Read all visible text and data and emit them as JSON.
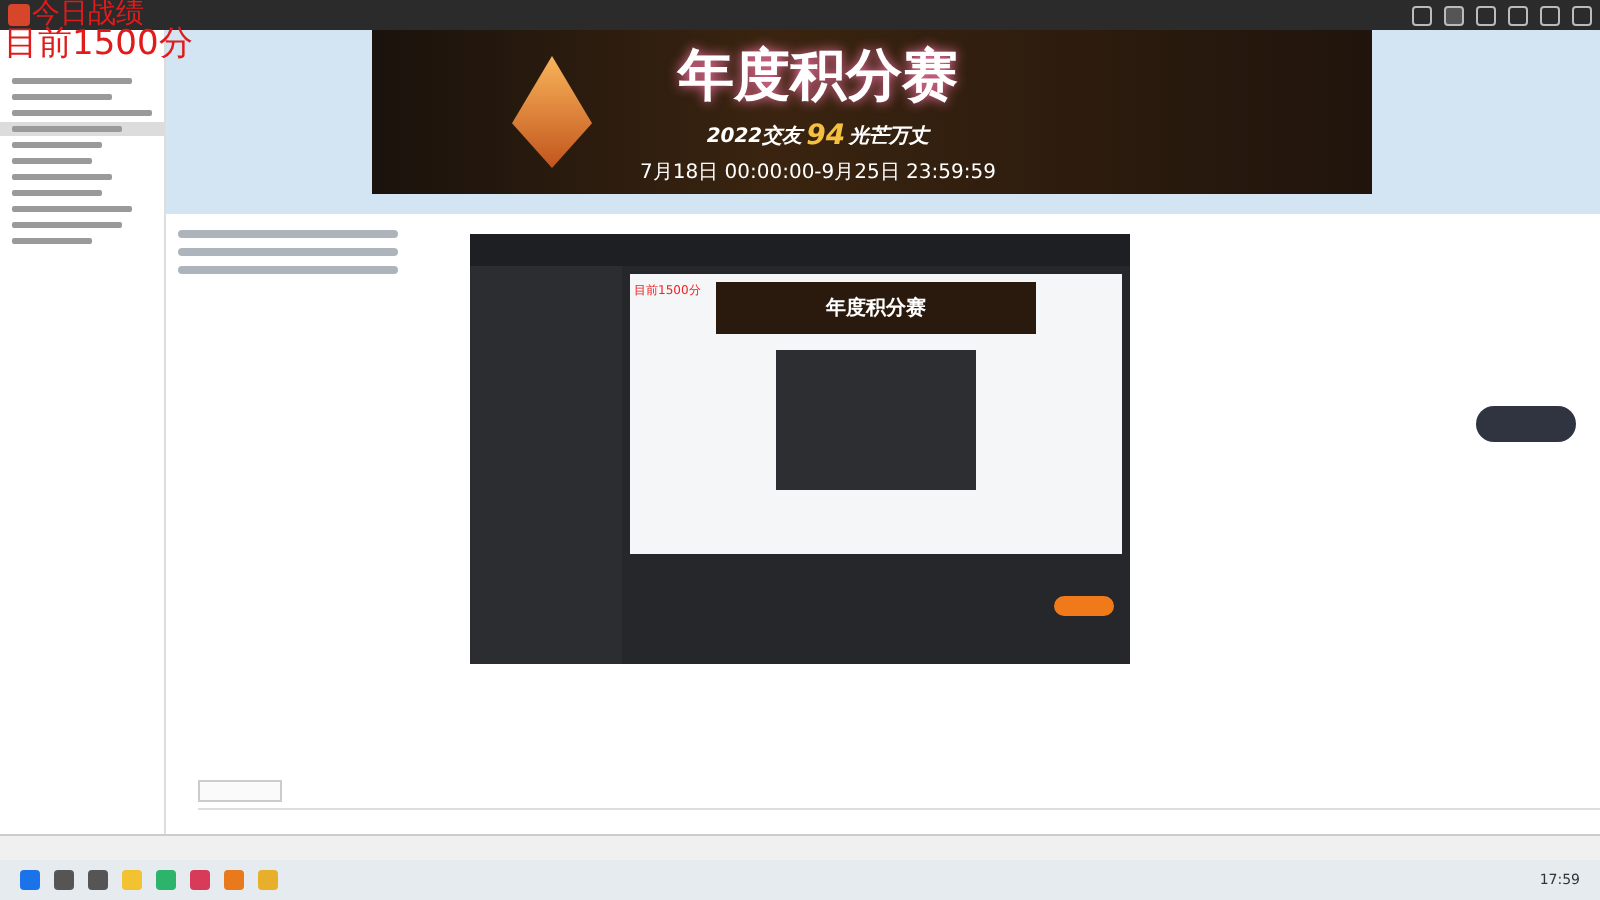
{
  "overlay": {
    "line_1": "今日战绩",
    "line_2": "目前1500分"
  },
  "sidebar": {
    "items": [
      {
        "selected": false
      },
      {
        "selected": false
      },
      {
        "selected": false
      },
      {
        "selected": true
      },
      {
        "selected": false
      },
      {
        "selected": false
      },
      {
        "selected": false
      },
      {
        "selected": false
      },
      {
        "selected": false
      },
      {
        "selected": false
      },
      {
        "selected": false
      }
    ]
  },
  "banner": {
    "title": "年度积分赛",
    "subtitle_before": "2022交友",
    "subtitle_highlight": "94",
    "subtitle_after": "光芒万丈",
    "dates": "7月18日 00:00:00-9月25日 23:59:59"
  },
  "embedded_window": {
    "overlay_text": "目前1500分",
    "inner_banner_title": "年度积分赛"
  },
  "taskbar": {
    "time": "17:59"
  }
}
